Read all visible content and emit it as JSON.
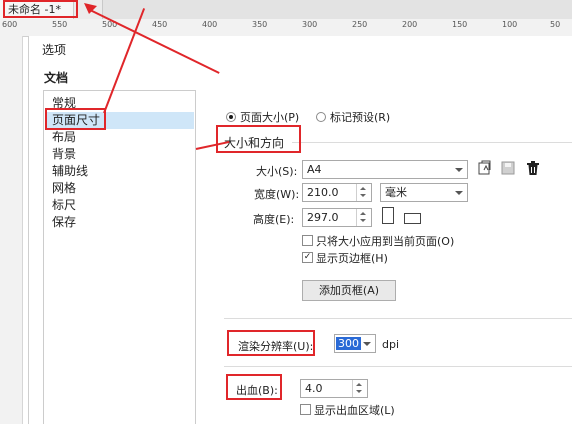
{
  "document_tab": {
    "title": "未命名 -1*"
  },
  "ruler": {
    "ticks": [
      "600",
      "550",
      "500",
      "450",
      "400",
      "350",
      "300",
      "250",
      "200",
      "150",
      "100",
      "50"
    ]
  },
  "dialog": {
    "title": "选项",
    "section": "文档",
    "nav": [
      {
        "label": "常规"
      },
      {
        "label": "页面尺寸",
        "selected": true
      },
      {
        "label": "布局"
      },
      {
        "label": "背景"
      },
      {
        "label": "辅助线"
      },
      {
        "label": "网格"
      },
      {
        "label": "标尺"
      },
      {
        "label": "保存"
      }
    ]
  },
  "page_size": {
    "radio_page_size": "页面大小(P)",
    "radio_label_preset": "标记预设(R)",
    "group_title": "大小和方向",
    "size_label": "大小(S):",
    "size_value": "A4",
    "width_label": "宽度(W):",
    "width_value": "210.0",
    "unit_value": "毫米",
    "height_label": "高度(E):",
    "height_value": "297.0",
    "apply_current_only": "只将大小应用到当前页面(O)",
    "show_page_border": "显示页边框(H)",
    "add_border_button": "添加页框(A)",
    "render_resolution_label": "渲染分辨率(U):",
    "render_resolution_value": "300",
    "dpi_label": "dpi",
    "bleed_label": "出血(B):",
    "bleed_value": "4.0",
    "show_bleed_area": "显示出血区域(L)"
  },
  "state": {
    "radio_page_size_checked": true,
    "apply_current_only_checked": false,
    "show_page_border_checked": true,
    "show_bleed_area_checked": false
  },
  "colors": {
    "annotation": "#e0262a",
    "selection": "#cfe6f8",
    "highlight_text": "#2a6ad6"
  },
  "icons": [
    "save-preset-icon",
    "save-disk-icon",
    "delete-trash-icon",
    "portrait-icon",
    "landscape-icon"
  ]
}
